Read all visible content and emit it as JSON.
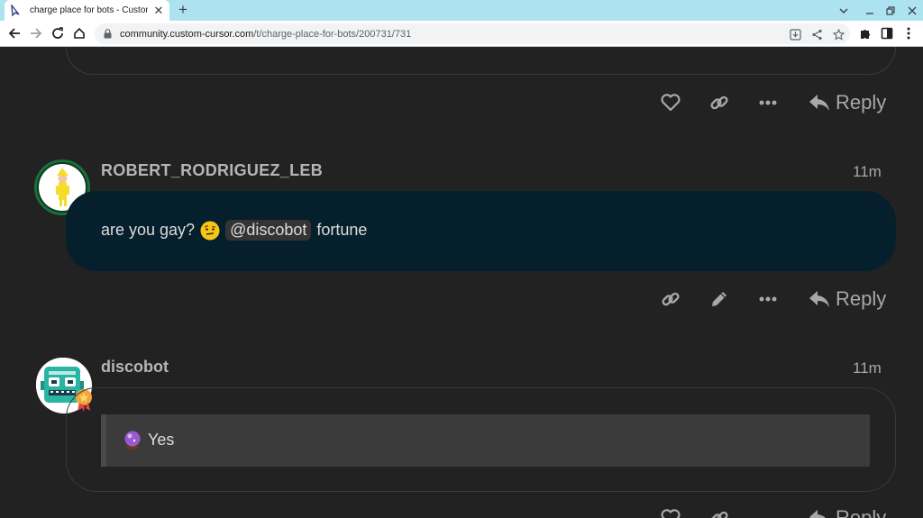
{
  "browser": {
    "tab_title": "charge place for bots - Custom C",
    "url_host": "community.custom-cursor.com",
    "url_path": "/t/charge-place-for-bots/200731/731"
  },
  "top_actions": {
    "reply_label": "Reply"
  },
  "posts": [
    {
      "username": "ROBERT_RODRIGUEZ_LEB",
      "time": "11m",
      "text_before": "are you gay?",
      "mention": "@discobot",
      "text_after": "fortune",
      "reply_label": "Reply"
    },
    {
      "username": "discobot",
      "time": "11m",
      "quote_text": "Yes",
      "reply_label": "Reply"
    }
  ],
  "colors": {
    "background": "#222222",
    "highlight_bubble": "#05202c",
    "quote_bg": "#3b3b3b",
    "muted_text": "#a8a8a8"
  }
}
